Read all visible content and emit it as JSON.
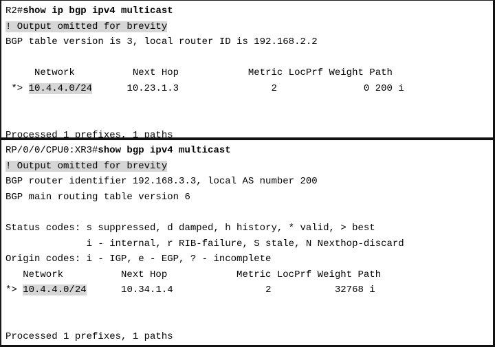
{
  "document": {
    "title": "show ip bgp ipv4 multicast / show bgp ipv4 multicast comparison",
    "background_color": "#ffffff",
    "text_color": "#000000",
    "highlight_color": "#d6d6d6",
    "border_color": "#111111"
  },
  "panels": [
    {
      "id": "panel-ios-r2",
      "device": "R2",
      "prompt": "R2#",
      "command": "show ip bgp ipv4 multicast",
      "lines": [
        {
          "id": "p1l1",
          "type": "command",
          "prompt": "R2#",
          "command": "show ip bgp ipv4 multicast"
        },
        {
          "id": "p1l2",
          "type": "highlight",
          "text": "! Output omitted for brevity"
        },
        {
          "id": "p1l3",
          "type": "text",
          "text": "BGP table version is 3, local router ID is 192.168.2.2"
        },
        {
          "id": "p1l4",
          "type": "blank",
          "text": ""
        },
        {
          "id": "p1l5",
          "type": "text",
          "text": "     Network          Next Hop            Metric LocPrf Weight Path"
        },
        {
          "id": "p1l6",
          "type": "route",
          "pre": " *> ",
          "prefix": "10.4.4.0/24",
          "post": "      10.23.1.3                2               0 200 i"
        },
        {
          "id": "p1l7",
          "type": "blank",
          "text": ""
        },
        {
          "id": "p1l8",
          "type": "blank",
          "text": ""
        },
        {
          "id": "p1l9",
          "type": "text",
          "text": "Processed 1 prefixes, 1 paths"
        }
      ],
      "table": {
        "headers": [
          "Network",
          "Next Hop",
          "Metric",
          "LocPrf",
          "Weight",
          "Path"
        ],
        "rows": [
          {
            "status": "*>",
            "network": "10.4.4.0/24",
            "next_hop": "10.23.1.3",
            "metric": "2",
            "locprf": "",
            "weight": "0",
            "path": "200 i"
          }
        ]
      },
      "summary": {
        "bgp_table_version": "3",
        "local_router_id": "192.168.2.2",
        "processed_prefixes": "1",
        "processed_paths": "1"
      }
    },
    {
      "id": "panel-xr-xr3",
      "device": "XR3",
      "prompt": "RP/0/0/CPU0:XR3#",
      "command": "show bgp ipv4 multicast",
      "lines": [
        {
          "id": "p2l1",
          "type": "command",
          "prompt": "RP/0/0/CPU0:XR3#",
          "command": "show bgp ipv4 multicast"
        },
        {
          "id": "p2l2",
          "type": "highlight",
          "text": "! Output omitted for brevity"
        },
        {
          "id": "p2l3",
          "type": "text",
          "text": "BGP router identifier 192.168.3.3, local AS number 200"
        },
        {
          "id": "p2l4",
          "type": "text",
          "text": "BGP main routing table version 6"
        },
        {
          "id": "p2l5",
          "type": "blank",
          "text": ""
        },
        {
          "id": "p2l6",
          "type": "text",
          "text": "Status codes: s suppressed, d damped, h history, * valid, > best"
        },
        {
          "id": "p2l7",
          "type": "text",
          "text": "              i - internal, r RIB-failure, S stale, N Nexthop-discard"
        },
        {
          "id": "p2l8",
          "type": "text",
          "text": "Origin codes: i - IGP, e - EGP, ? - incomplete"
        },
        {
          "id": "p2l9",
          "type": "text",
          "text": "   Network          Next Hop            Metric LocPrf Weight Path"
        },
        {
          "id": "p2l10",
          "type": "route",
          "pre": "*> ",
          "prefix": "10.4.4.0/24",
          "post": "      10.34.1.4                2           32768 i"
        },
        {
          "id": "p2l11",
          "type": "blank",
          "text": ""
        },
        {
          "id": "p2l12",
          "type": "blank",
          "text": ""
        },
        {
          "id": "p2l13",
          "type": "text",
          "text": "Processed 1 prefixes, 1 paths"
        }
      ],
      "table": {
        "headers": [
          "Network",
          "Next Hop",
          "Metric",
          "LocPrf",
          "Weight",
          "Path"
        ],
        "rows": [
          {
            "status": "*>",
            "network": "10.4.4.0/24",
            "next_hop": "10.34.1.4",
            "metric": "2",
            "locprf": "",
            "weight": "32768",
            "path": "i"
          }
        ]
      },
      "summary": {
        "bgp_router_identifier": "192.168.3.3",
        "local_as_number": "200",
        "bgp_main_routing_table_version": "6",
        "processed_prefixes": "1",
        "processed_paths": "1"
      },
      "legend": {
        "status_codes": "s suppressed, d damped, h history, * valid, > best, i - internal, r RIB-failure, S stale, N Nexthop-discard",
        "origin_codes": "i - IGP, e - EGP, ? - incomplete"
      }
    }
  ]
}
